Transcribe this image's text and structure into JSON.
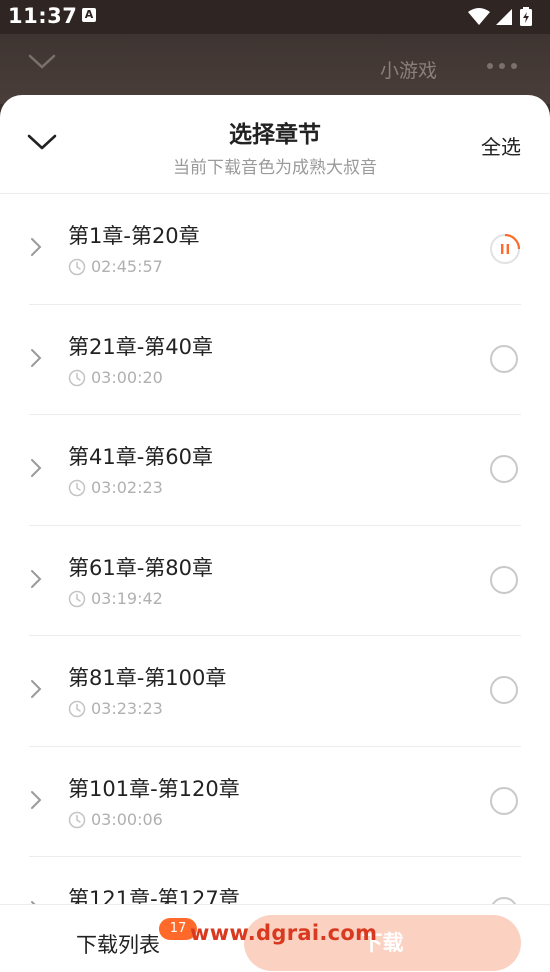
{
  "status_bar": {
    "time": "11:37",
    "notification_icon": "A"
  },
  "background_header": {
    "mini_game_label": "小游戏"
  },
  "sheet": {
    "title": "选择章节",
    "subtitle": "当前下载音色为成熟大叔音",
    "select_all": "全选"
  },
  "chapters": [
    {
      "name": "第1章-第20章",
      "duration": "02:45:57",
      "state": "downloading-paused"
    },
    {
      "name": "第21章-第40章",
      "duration": "03:00:20",
      "state": "unselected"
    },
    {
      "name": "第41章-第60章",
      "duration": "03:02:23",
      "state": "unselected"
    },
    {
      "name": "第61章-第80章",
      "duration": "03:19:42",
      "state": "unselected"
    },
    {
      "name": "第81章-第100章",
      "duration": "03:23:23",
      "state": "unselected"
    },
    {
      "name": "第101章-第120章",
      "duration": "03:00:06",
      "state": "unselected"
    },
    {
      "name": "第121章-第127章",
      "duration": "",
      "state": "unselected"
    }
  ],
  "bottom_bar": {
    "download_list": "下载列表",
    "badge_count": "17",
    "download_button": "下载",
    "watermark": "www.dgrai.com"
  },
  "colors": {
    "accent": "#ff6a2a",
    "button_disabled": "#fbd1c2",
    "watermark": "#d9391f"
  }
}
